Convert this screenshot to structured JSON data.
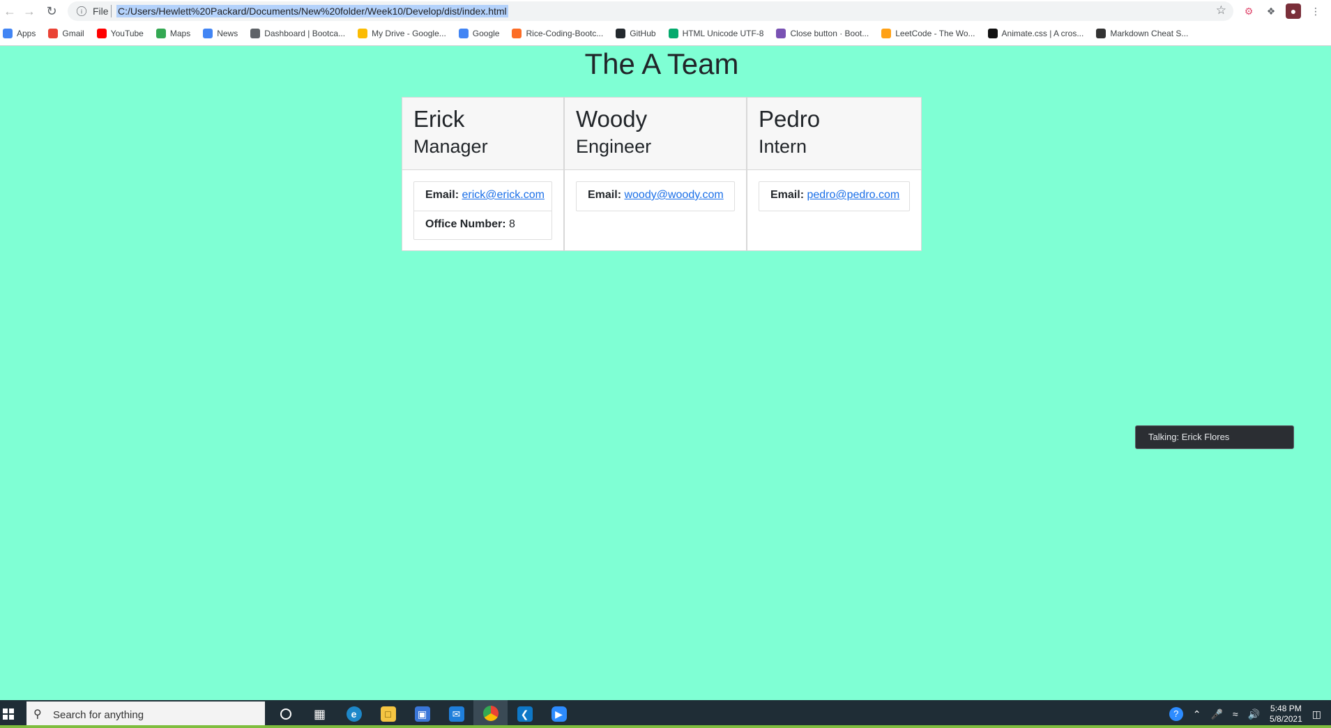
{
  "browser": {
    "omnibox_scheme": "File",
    "url": "C:/Users/Hewlett%20Packard/Documents/New%20folder/Week10/Develop/dist/index.html",
    "bookmarks": [
      {
        "label": "Apps",
        "icon": "apps-grid-icon",
        "color": "#4285f4"
      },
      {
        "label": "Gmail",
        "icon": "gmail-icon",
        "color": "#ea4335"
      },
      {
        "label": "YouTube",
        "icon": "youtube-icon",
        "color": "#ff0000"
      },
      {
        "label": "Maps",
        "icon": "maps-pin-icon",
        "color": "#34a853"
      },
      {
        "label": "News",
        "icon": "news-icon",
        "color": "#4285f4"
      },
      {
        "label": "Dashboard | Bootca...",
        "icon": "dashboard-icon",
        "color": "#5f6368"
      },
      {
        "label": "My Drive - Google...",
        "icon": "google-drive-icon",
        "color": "#fbbc04"
      },
      {
        "label": "Google",
        "icon": "google-icon",
        "color": "#4285f4"
      },
      {
        "label": "Rice-Coding-Bootc...",
        "icon": "gitlab-icon",
        "color": "#fc6d26"
      },
      {
        "label": "GitHub",
        "icon": "github-icon",
        "color": "#24292e"
      },
      {
        "label": "HTML Unicode UTF-8",
        "icon": "w3schools-icon",
        "color": "#04aa6d"
      },
      {
        "label": "Close button · Boot...",
        "icon": "bootstrap-icon",
        "color": "#7952b3"
      },
      {
        "label": "LeetCode - The Wo...",
        "icon": "leetcode-icon",
        "color": "#ffa116"
      },
      {
        "label": "Animate.css | A cros...",
        "icon": "animate-icon",
        "color": "#111111"
      },
      {
        "label": "Markdown Cheat S...",
        "icon": "markdown-icon",
        "color": "#333333"
      }
    ]
  },
  "page": {
    "title": "The A Team",
    "background": "#7fffd4",
    "team": [
      {
        "name": "Erick",
        "role": "Manager",
        "email_label": "Email:",
        "email": "erick@erick.com",
        "extra_label": "Office Number:",
        "extra_value": "8"
      },
      {
        "name": "Woody",
        "role": "Engineer",
        "email_label": "Email:",
        "email": "woody@woody.com"
      },
      {
        "name": "Pedro",
        "role": "Intern",
        "email_label": "Email:",
        "email": "pedro@pedro.com"
      }
    ]
  },
  "toast": {
    "text": "Talking: Erick Flores"
  },
  "taskbar": {
    "search_placeholder": "Search for anything",
    "apps": [
      "cortana-icon",
      "task-view-icon",
      "edge-icon",
      "file-explorer-icon",
      "store-icon",
      "mail-icon",
      "chrome-icon",
      "vscode-icon",
      "zoom-icon"
    ],
    "active_app": "chrome-icon",
    "time": "5:48 PM",
    "date": "5/8/2021"
  }
}
